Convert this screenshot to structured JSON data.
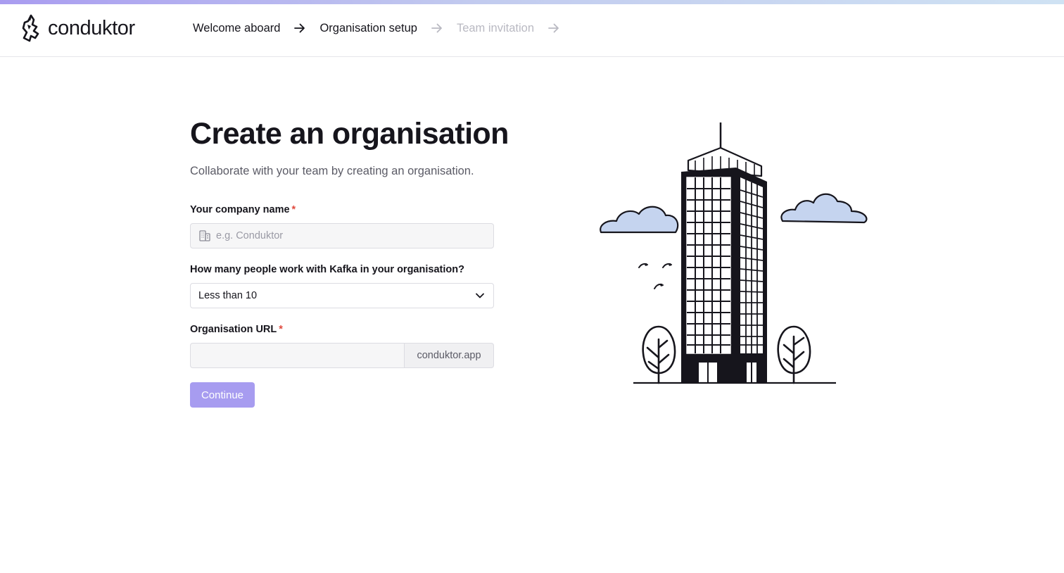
{
  "brand": {
    "name": "conduktor",
    "accent": "#a79cf0"
  },
  "steps": [
    {
      "label": "Welcome aboard",
      "state": "done"
    },
    {
      "label": "Organisation setup",
      "state": "current"
    },
    {
      "label": "Team invitation",
      "state": "upcoming"
    }
  ],
  "page": {
    "title": "Create an organisation",
    "subtitle": "Collaborate with your team by creating an organisation."
  },
  "form": {
    "company": {
      "label": "Your company name",
      "required_mark": "*",
      "placeholder": "e.g. Conduktor",
      "value": "",
      "icon": "building-icon"
    },
    "team_size": {
      "label": "How many people work with Kafka in your organisation?",
      "value": "Less than 10",
      "icon": "chevron-down-icon"
    },
    "org_url": {
      "label": "Organisation URL",
      "required_mark": "*",
      "value": "",
      "suffix": "conduktor.app"
    },
    "continue_label": "Continue"
  },
  "colors": {
    "required": "#e04b3f",
    "cloud": "#c5d4ef",
    "ink": "#16151c",
    "muted_step": "#b9b9c2"
  }
}
